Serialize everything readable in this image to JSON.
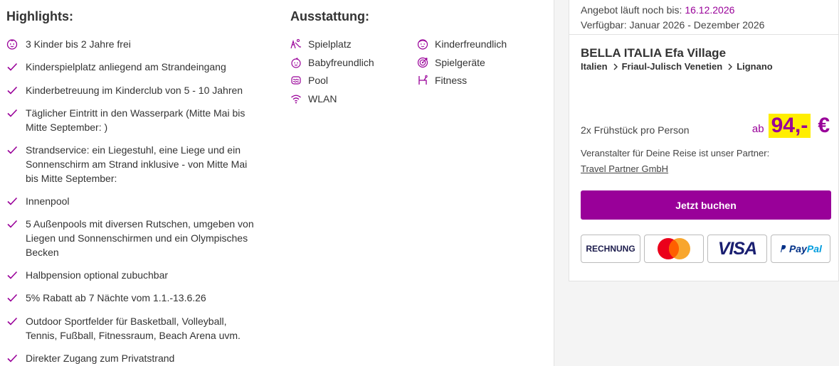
{
  "highlights": {
    "title": "Highlights:",
    "items": [
      "3 Kinder bis 2 Jahre frei",
      "Kinderspielplatz anliegend am Strandeingang",
      "Kinderbetreuung im Kinderclub von 5 - 10 Jahren",
      "Täglicher Eintritt in den Wasserpark (Mitte Mai bis Mitte September: )",
      "Strandservice: ein Liegestuhl, eine Liege und ein Sonnenschirm am Strand inklusive - von Mitte Mai bis Mitte September:",
      "Innenpool",
      "5 Außenpools mit diversen Rutschen, umgeben von Liegen und Sonnenschirmen und ein Olympisches Becken",
      "Halbpension optional zubuchbar",
      "5% Rabatt ab 7 Nächte vom 1.1.-13.6.26",
      "Outdoor Sportfelder für Basketball, Volleyball, Tennis, Fußball, Fitnessraum, Beach Arena uvm.",
      "Direkter Zugang zum Privatstrand"
    ]
  },
  "ausstattung": {
    "title": "Ausstattung:",
    "items": {
      "spielplatz": "Spielplatz",
      "babyfreundlich": "Babyfreundlich",
      "pool": "Pool",
      "wlan": "WLAN",
      "kinderfreundlich": "Kinderfreundlich",
      "spielgeraete": "Spielgeräte",
      "fitness": "Fitness"
    }
  },
  "offer": {
    "valid_label": "Angebot läuft noch bis:",
    "valid_date": "16.12.2026",
    "available": "Verfügbar: Januar 2026 - Dezember 2026"
  },
  "hotel": {
    "name": "BELLA ITALIA Efa Village",
    "breadcrumb": [
      "Italien",
      "Friaul-Julisch Venetien",
      "Lignano"
    ]
  },
  "pricing": {
    "board": "2x Frühstück pro Person",
    "prefix": "ab",
    "amount": "94,-",
    "currency": "€"
  },
  "partner": {
    "label": "Veranstalter für Deine Reise ist unser Partner:",
    "name": "Travel Partner GmbH"
  },
  "book_label": "Jetzt buchen",
  "payment": {
    "rechnung": "RECHNUNG",
    "visa": "VISA",
    "paypal_a": "Pay",
    "paypal_b": "Pal"
  },
  "colors": {
    "accent": "#990099",
    "price_highlight": "#ffee00"
  }
}
